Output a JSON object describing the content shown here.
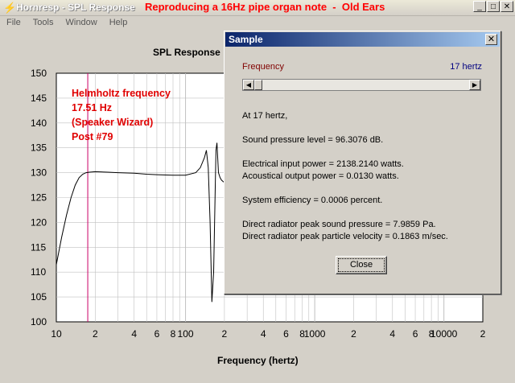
{
  "window": {
    "title": "Hornresp - SPL Response",
    "overlay_title": "Reproducing a 16Hz pipe organ note  -  Old Ears",
    "buttons": {
      "minimize": "_",
      "maximize": "□",
      "close": "✕"
    }
  },
  "menu": {
    "items": [
      "File",
      "Tools",
      "Window",
      "Help"
    ]
  },
  "chart": {
    "title": "SPL Response",
    "xlabel": "Frequency (hertz)",
    "y_ticks": [
      "150",
      "145",
      "140",
      "135",
      "130",
      "125",
      "120",
      "115",
      "110",
      "105",
      "100"
    ],
    "x_ticks": [
      "10",
      "2",
      "4",
      "6",
      "8",
      "100",
      "2",
      "4",
      "6",
      "8",
      "1000",
      "2",
      "4",
      "6",
      "8",
      "10000",
      "2"
    ],
    "annotation": [
      "Helmholtz frequency",
      "17.51 Hz",
      "(Speaker Wizard)",
      "Post #79"
    ]
  },
  "chart_data": {
    "type": "line",
    "title": "SPL Response",
    "xlabel": "Frequency (hertz)",
    "ylabel": "",
    "x_scale": "log",
    "xlim": [
      10,
      20000
    ],
    "ylim": [
      100,
      150
    ],
    "grid": true,
    "marker_line_hz": 17.51,
    "series": [
      {
        "x": [
          10,
          11,
          12,
          13,
          14,
          15,
          16,
          17,
          18,
          20,
          25,
          30,
          40,
          50,
          60,
          80,
          100,
          120,
          130,
          140,
          145,
          150,
          155,
          160,
          165,
          170,
          172,
          175,
          180,
          185,
          190,
          200
        ],
        "y": [
          111.5,
          117,
          121.5,
          125,
          127.5,
          129,
          129.7,
          130,
          130.1,
          130.2,
          130.1,
          130,
          129.9,
          129.7,
          129.6,
          129.5,
          129.5,
          130,
          131,
          133,
          134.5,
          131,
          120,
          104,
          110,
          128,
          134.5,
          136,
          130,
          129,
          128.5,
          128
        ]
      }
    ]
  },
  "dialog": {
    "title": "Sample",
    "close_icon": "✕",
    "frequency_label": "Frequency",
    "frequency_value": "17 hertz",
    "slider_fraction": 0.0,
    "lines": [
      "At 17 hertz,",
      "Sound pressure level = 96.3076 dB.",
      "Electrical input power = 2138.2140 watts.",
      "Acoustical output power = 0.0130 watts.",
      "System efficiency = 0.0006 percent.",
      "Direct radiator peak sound pressure = 7.9859 Pa.",
      "Direct radiator peak particle velocity = 0.1863 m/sec."
    ],
    "close_label": "Close"
  },
  "colors": {
    "curve": "#000000",
    "marker": "#cc0066",
    "annotation": "#e00000",
    "grid": "#c0c0c0"
  }
}
